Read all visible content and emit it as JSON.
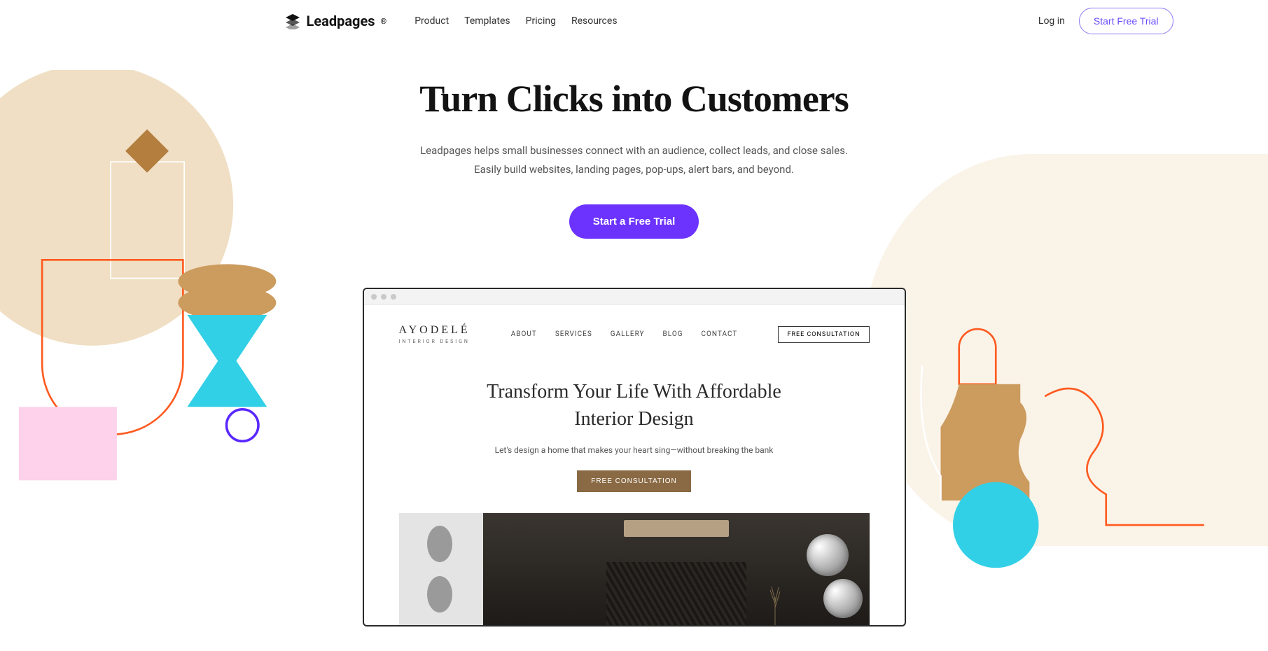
{
  "header": {
    "brand": "Leadpages",
    "nav": [
      "Product",
      "Templates",
      "Pricing",
      "Resources"
    ],
    "login": "Log in",
    "trial_btn": "Start Free Trial"
  },
  "hero": {
    "title": "Turn Clicks into Customers",
    "sub1": "Leadpages helps small businesses connect with an audience, collect leads, and close sales.",
    "sub2": "Easily build websites, landing pages, pop-ups, alert bars, and beyond.",
    "cta": "Start a Free Trial"
  },
  "mockup": {
    "brand": "AYODELÉ",
    "brand_sub": "INTERIOR DESIGN",
    "nav": [
      "ABOUT",
      "SERVICES",
      "GALLERY",
      "BLOG",
      "CONTACT"
    ],
    "header_cta": "FREE CONSULTATION",
    "headline1": "Transform Your Life With Affordable",
    "headline2": "Interior Design",
    "sub": "Let's design a home that makes your heart sing—without breaking the bank",
    "cta": "FREE CONSULTATION"
  },
  "colors": {
    "primary": "#6c33ff",
    "outline": "#6c4cff",
    "tan": "#e4c599",
    "tan_dark": "#cc9b5e",
    "cyan": "#32d0e6",
    "pink": "#fdd2ea",
    "orange": "#ff5a1f",
    "purple_ring": "#5a28ff"
  }
}
